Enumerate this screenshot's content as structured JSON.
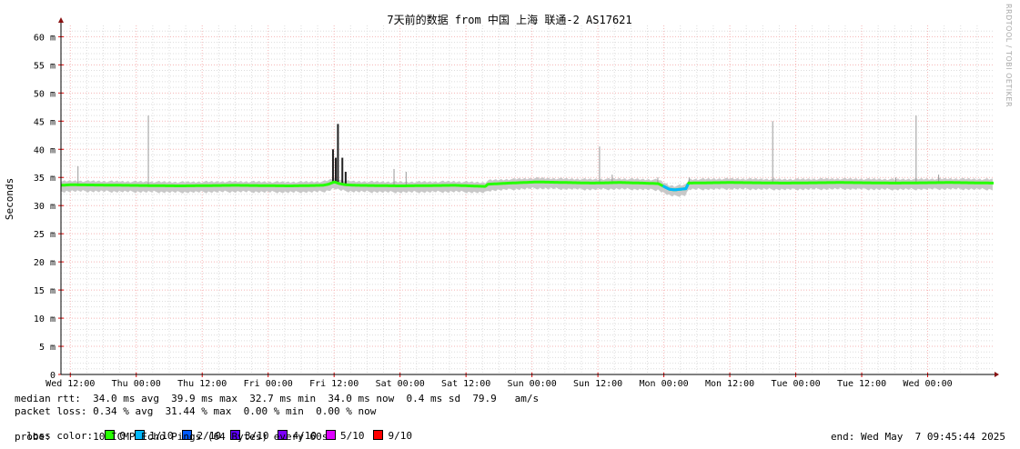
{
  "chart_data": {
    "type": "line",
    "title": "7天前的数据 from 中国 上海 联通-2 AS17621",
    "ylabel": "Seconds",
    "xlabel": "",
    "ylim": [
      0,
      62
    ],
    "y_ticks": [
      0,
      5,
      10,
      15,
      20,
      25,
      30,
      35,
      40,
      45,
      50,
      55,
      60
    ],
    "y_tick_labels": [
      "0",
      "5 m",
      "10 m",
      "15 m",
      "20 m",
      "25 m",
      "30 m",
      "35 m",
      "40 m",
      "45 m",
      "50 m",
      "55 m",
      "60 m"
    ],
    "x_range_hours": [
      -1.7,
      168
    ],
    "x_tick_labels": [
      "Wed 12:00",
      "Thu 00:00",
      "Thu 12:00",
      "Fri 00:00",
      "Fri 12:00",
      "Sat 00:00",
      "Sat 12:00",
      "Sun 00:00",
      "Sun 12:00",
      "Mon 00:00",
      "Mon 12:00",
      "Tue 00:00",
      "Tue 12:00",
      "Wed 00:00"
    ],
    "x_tick_hours": [
      0,
      12,
      24,
      36,
      48,
      60,
      72,
      84,
      96,
      108,
      120,
      132,
      144,
      156
    ],
    "grid": true,
    "series": [
      {
        "name": "median rtt",
        "hours": [
          -1.7,
          0,
          10,
          20,
          30,
          40,
          46,
          47,
          48,
          49,
          50,
          52,
          60,
          70,
          75.5,
          76,
          80,
          85,
          90,
          95,
          100,
          104,
          107,
          108,
          109,
          110,
          111,
          112,
          112.5,
          120,
          130,
          140,
          150,
          160,
          168
        ],
        "values": [
          33.6,
          33.7,
          33.6,
          33.5,
          33.6,
          33.5,
          33.6,
          33.8,
          34.2,
          33.9,
          33.7,
          33.6,
          33.5,
          33.6,
          33.4,
          33.8,
          34.0,
          34.2,
          34.1,
          34.0,
          34.1,
          34.0,
          33.9,
          33.4,
          32.9,
          32.8,
          32.9,
          33.0,
          34.0,
          34.1,
          34.0,
          34.1,
          34.0,
          34.1,
          34.0
        ]
      },
      {
        "name": "latency spikes",
        "hours": [
          1.4,
          14.2,
          47.8,
          48.3,
          48.7,
          49.5,
          50.1,
          58.9,
          61.1,
          96.3,
          98.6,
          106.9,
          112.6,
          127.8,
          150.2,
          153.9,
          158.0
        ],
        "values": [
          37.0,
          46.0,
          40.0,
          38.5,
          44.5,
          38.5,
          36.0,
          36.5,
          36.0,
          40.5,
          35.5,
          35.0,
          35.0,
          45.0,
          35.0,
          46.0,
          35.5
        ]
      }
    ],
    "colors": {
      "background": "#ffffff",
      "grid_minor": "#dddddd",
      "grid_major": "#f5b5b5",
      "axis": "#000000",
      "arrow": "#881111",
      "smoke": "#999999",
      "loss_0": "#26ff00",
      "loss_1_10": "#00b8ff",
      "loss_2_10": "#0059ff",
      "loss_3_10": "#5e00ff",
      "loss_4_10": "#7e00ff",
      "loss_5_10": "#dd00ff",
      "loss_9_10": "#ff0000"
    }
  },
  "stats": {
    "median_rtt": "median rtt:  34.0 ms avg  39.9 ms max  32.7 ms min  34.0 ms now  0.4 ms sd  79.9   am/s",
    "packet_loss": "packet loss: 0.34 % avg  31.44 % max  0.00 % min  0.00 % now",
    "loss_color_label": "loss color:",
    "loss_colors": [
      {
        "label": "0",
        "color": "#26ff00"
      },
      {
        "label": "1/10",
        "color": "#00b8ff"
      },
      {
        "label": "2/10",
        "color": "#0059ff"
      },
      {
        "label": "3/10",
        "color": "#5e00ff"
      },
      {
        "label": "4/10",
        "color": "#7e00ff"
      },
      {
        "label": "5/10",
        "color": "#dd00ff"
      },
      {
        "label": "9/10",
        "color": "#ff0000"
      }
    ],
    "probe": "probe:       10 ICMP Echo Pings (64 Bytes) every 60s",
    "end": "end: Wed May  7 09:45:44 2025"
  },
  "watermark": "RRDTOOL / TOBI OETIKER"
}
